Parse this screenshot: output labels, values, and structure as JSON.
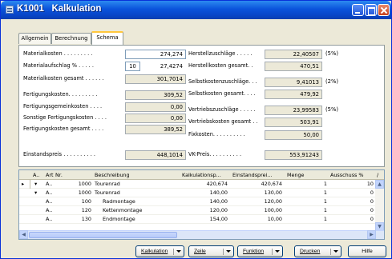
{
  "window": {
    "title": "K1001   Kalkulation",
    "colors": {
      "title_bar": "#0A53DB",
      "face": "#ECE9D8",
      "tab_highlight": "#FFC73C",
      "selection": "#316AC5"
    }
  },
  "tabs": [
    {
      "label": "Allgemein",
      "active": false
    },
    {
      "label": "Berechnung",
      "active": false
    },
    {
      "label": "Schema",
      "active": true
    }
  ],
  "left_fields": {
    "materialkosten": {
      "label": "Materialkosten . . . . . . . . .",
      "value": "274,274"
    },
    "materialaufschlag": {
      "label": "Materialaufschlag % . . . . .",
      "percent": "10",
      "value": "27,4274"
    },
    "materialkosten_gesamt": {
      "label": "Materialkosten gesamt . . . . . .",
      "value": "301,7014"
    },
    "fertigungskosten": {
      "label": "Fertigungskosten. . . . . . . . .",
      "value": "309,52"
    },
    "fertigungsgemeinkosten": {
      "label": "Fertigungsgemeinkosten . . . .",
      "value": "0,00"
    },
    "sonstige_fertigungskosten": {
      "label": "Sonstige Fertigungskosten . . . .",
      "value": "0,00"
    },
    "fertigungskosten_gesamt": {
      "label": "Fertigungskosten gesamt . . . .",
      "value": "389,52"
    },
    "einstandspreis": {
      "label": "Einstandspreis . . . . . . . . . .",
      "value": "448,1014"
    }
  },
  "right_fields": {
    "herstellzuschlaege": {
      "label": "Herstellzuschläge . . . . .",
      "value": "22,40507",
      "pct": "(5%)"
    },
    "herstellkosten_gesamt": {
      "label": "Herstellkosten gesamt. .",
      "value": "470,51"
    },
    "selbstkostenzuschlaege": {
      "label": "Selbstkostenzuschläge. . .",
      "value": "9,41013",
      "pct": "(2%)"
    },
    "selbstkosten_gesamt": {
      "label": "Selbstkosten gesamt. . . .",
      "value": "479,92"
    },
    "vertriebszuschlaege": {
      "label": "Vertriebszuschläge . . . . .",
      "value": "23,99583",
      "pct": "(5%)"
    },
    "vertriebskosten_gesamt": {
      "label": "Vertriebskosten gesamt . .",
      "value": "503,91"
    },
    "fixkosten": {
      "label": "Fixkosten. . . . . . . . . .",
      "value": "50,00"
    },
    "vk_preis": {
      "label": "VK-Preis. . . . . . . . . .",
      "value": "553,91243"
    }
  },
  "grid": {
    "columns": [
      "A..",
      "Art",
      "Nr.",
      "Beschreibung",
      "Kalkulationsp...",
      "Einstandsprei...",
      "Menge",
      "Ausschuss %",
      "/"
    ],
    "rows": [
      {
        "marker": "▸",
        "expand": "▾",
        "art": "A..",
        "nr": "1000",
        "beschreibung": "Tourenrad",
        "kalk": "420,674",
        "einst": "420,674",
        "menge": "1",
        "ausschuss": "10"
      },
      {
        "marker": "",
        "expand": "▾",
        "art": "A..",
        "nr": "1000",
        "beschreibung": "Tourenrad",
        "kalk": "140,00",
        "einst": "130,00",
        "menge": "1",
        "ausschuss": "0"
      },
      {
        "marker": "",
        "expand": "",
        "art": "A..",
        "nr": "100",
        "beschreibung": "Radmontage",
        "kalk": "140,00",
        "einst": "120,00",
        "menge": "1",
        "ausschuss": "0"
      },
      {
        "marker": "",
        "expand": "",
        "art": "A..",
        "nr": "120",
        "beschreibung": "Kettenmontage",
        "kalk": "120,00",
        "einst": "100,00",
        "menge": "1",
        "ausschuss": "0"
      },
      {
        "marker": "",
        "expand": "",
        "art": "A..",
        "nr": "130",
        "beschreibung": "Endmontage",
        "kalk": "154,00",
        "einst": "10,00",
        "menge": "1",
        "ausschuss": "0"
      }
    ]
  },
  "buttons": {
    "kalkulation": "Kalkulation",
    "zeile": "Zeile",
    "funktion": "Funktion",
    "drucken": "Drucken",
    "hilfe": "Hilfe"
  }
}
